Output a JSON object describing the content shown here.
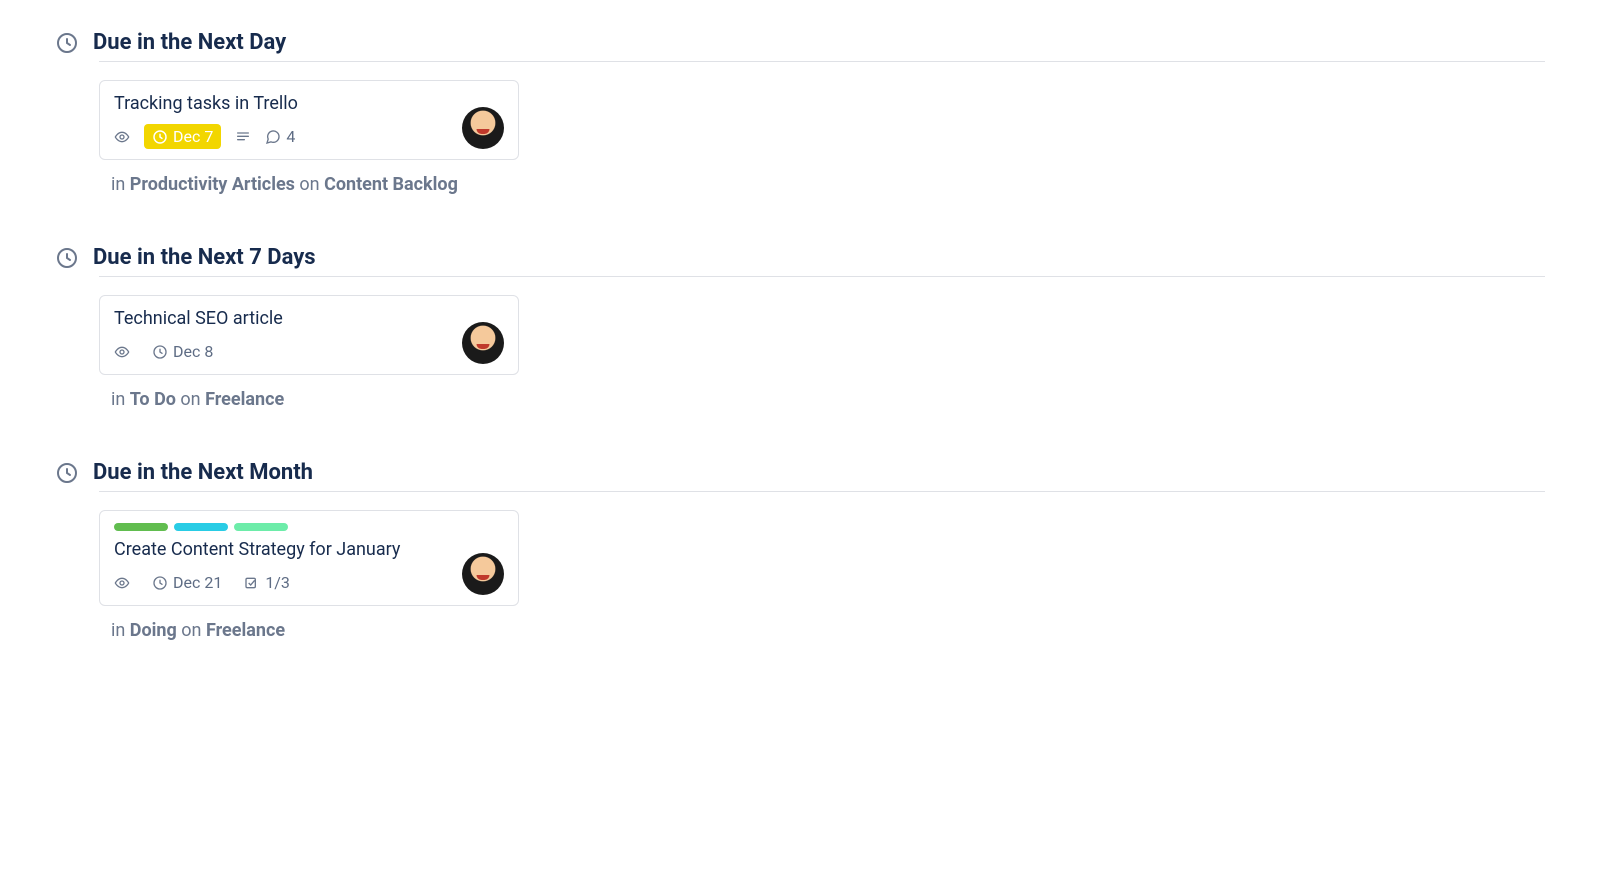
{
  "sections": [
    {
      "title": "Due in the Next Day",
      "card": {
        "title": "Tracking tasks in Trello",
        "labels": [],
        "watched": true,
        "due": "Dec 7",
        "dueStatus": "soon",
        "hasDescription": true,
        "comments": "4",
        "checklist": null,
        "location": {
          "in_prefix": "in ",
          "list": "Productivity Articles",
          "on_prefix": " on ",
          "board": "Content Backlog"
        }
      }
    },
    {
      "title": "Due in the Next 7 Days",
      "card": {
        "title": "Technical SEO article",
        "labels": [],
        "watched": true,
        "due": "Dec 8",
        "dueStatus": "normal",
        "hasDescription": false,
        "comments": null,
        "checklist": null,
        "location": {
          "in_prefix": "in ",
          "list": "To Do",
          "on_prefix": " on ",
          "board": "Freelance"
        }
      }
    },
    {
      "title": "Due in the Next Month",
      "card": {
        "title": "Create Content Strategy for January",
        "labels": [
          "#61bd4f",
          "#29cce5",
          "#6deca9"
        ],
        "watched": true,
        "due": "Dec 21",
        "dueStatus": "normal",
        "hasDescription": false,
        "comments": null,
        "checklist": "1/3",
        "location": {
          "in_prefix": "in ",
          "list": "Doing",
          "on_prefix": " on ",
          "board": "Freelance"
        }
      }
    }
  ]
}
